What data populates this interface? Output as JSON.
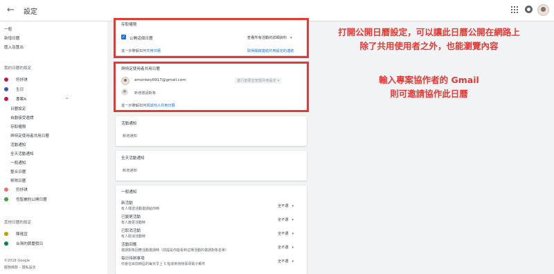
{
  "header": {
    "title": "設定"
  },
  "sidebar": {
    "general": "一般",
    "add_calendar": "新增日曆",
    "import_export": "匯入及匯出",
    "my_calendars_heading": "我的日曆的設定",
    "my_calendars": [
      {
        "name": "符妤琪",
        "color": "#b71c4a"
      },
      {
        "name": "生日",
        "color": "#3f51b5"
      },
      {
        "name": "專案A",
        "color": "#b71c4a"
      }
    ],
    "sub_items": [
      "日曆設定",
      "自動接受邀請",
      "存取權限",
      "與特定使用者共用日曆",
      "活動通知",
      "全天活動通知",
      "一般通知",
      "整合日曆",
      "移除日曆"
    ],
    "more_calendars": [
      {
        "name": "符妤琪",
        "color": "#e57373"
      },
      {
        "name": "恆智麗的公開日曆",
        "color": "#43a047"
      }
    ],
    "other_heading": "其他日曆的設定",
    "other_calendars": [
      {
        "name": "陳瑤宜",
        "color": "#c0a000"
      },
      {
        "name": "台灣的節慶假日",
        "color": "#0b8043"
      }
    ],
    "copyright": "©2018 Google",
    "terms": "服務條款 – 隱私設定"
  },
  "access": {
    "title": "存取權限",
    "public_label": "公開這個日曆",
    "public_checked": true,
    "visibility_select": "查看所有活動的詳細資料",
    "learn_more": "進一步瞭解如何",
    "learn_more_link": "共用日曆",
    "shareable_link": "取得開啟連結共用設定的連結"
  },
  "share": {
    "title": "與特定使用者共用日曆",
    "email": "amonkey0917@gmail.com",
    "permission_select": "進行變更並管理共用設定",
    "add_person": "新增邀請對象",
    "learn_more": "進一步瞭解如何",
    "learn_more_link": "與其他人共用日曆"
  },
  "event_notifications": {
    "title": "活動通知",
    "add": "新增通知"
  },
  "allday_notifications": {
    "title": "全天活動通知",
    "add": "新增通知"
  },
  "general_notifications": {
    "title": "一般通知",
    "items": [
      {
        "title": "新活動",
        "desc": "有人傳送活動邀請給你時",
        "value": "全不選"
      },
      {
        "title": "已變更活動",
        "desc": "有人變更活動時",
        "value": "全不選"
      },
      {
        "title": "已取消活動",
        "desc": "有人取消活動時",
        "value": "全不選"
      },
      {
        "title": "活動回應",
        "desc": "邀請對象回應活動邀請時（前提是你能看到這場活動的邀請對象名單）",
        "value": "全不選"
      },
      {
        "title": "每日待辦事項",
        "desc": "你會在目前時區的每天早上 5 點收到待辦事項電子郵件",
        "value": "全不選"
      }
    ]
  },
  "annotations": {
    "first": [
      "打開公開日曆設定，可以讓此日曆公開在網路上",
      "除了共用使用者之外，也能瀏覽內容"
    ],
    "second": [
      "輸入專案協作者的 Gmail",
      "則可邀請協作此日曆"
    ],
    "highlight_color": "#e53935"
  }
}
